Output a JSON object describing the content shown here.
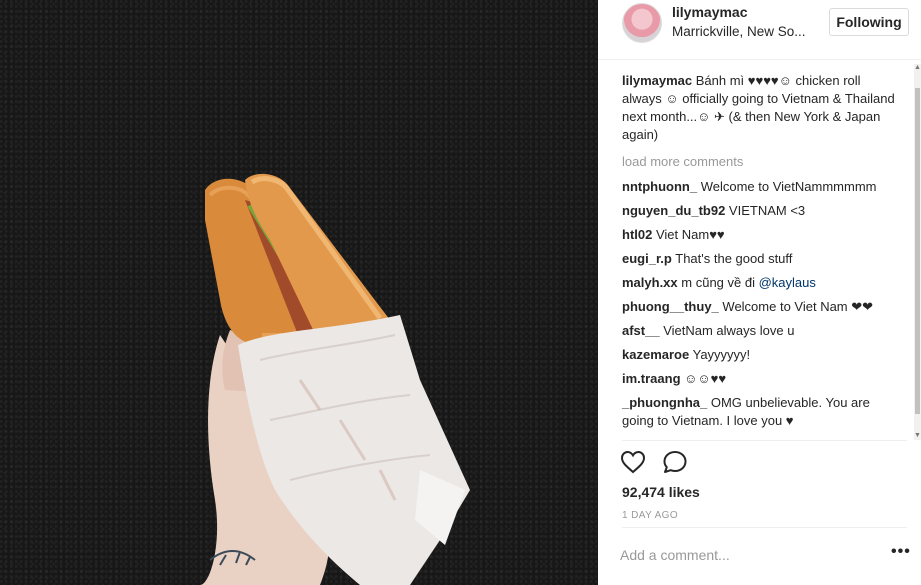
{
  "post": {
    "user": {
      "username": "lilymaymac",
      "location": "Marrickville, New So...",
      "follow_label": "Following"
    },
    "caption": {
      "username": "lilymaymac",
      "text": "Bánh mì ♥♥♥♥☺ chicken roll always ☺ officially going to Vietnam & Thailand next month...☺ ✈ (& then New York & Japan again)"
    },
    "load_more_label": "load more comments",
    "comments": [
      {
        "username": "nntphuonn_",
        "text": "Welcome to VietNammmmmm"
      },
      {
        "username": "nguyen_du_tb92",
        "text": "VIETNAM <3"
      },
      {
        "username": "htl02",
        "text": "Viet Nam♥♥"
      },
      {
        "username": "eugi_r.p",
        "text": "That's the good stuff"
      },
      {
        "username": "malyh.xx",
        "text": "m cũng về đi ",
        "mention": "@kaylaus"
      },
      {
        "username": "phuong__thuy_",
        "text": "Welcome to Viet Nam ❤❤"
      },
      {
        "username": "afst__",
        "text": "VietNam always love u"
      },
      {
        "username": "kazemaroe",
        "text": "Yayyyyyy!"
      },
      {
        "username": "im.traang",
        "text": "☺☺♥♥"
      },
      {
        "username": "_phuongnha_",
        "text": "OMG unbelievable. You are going to Vietnam. I love you ♥"
      }
    ],
    "likes": "92,474 likes",
    "timestamp": "1 DAY AGO",
    "add_comment_placeholder": "Add a comment...",
    "more_label": "•••",
    "icons": {
      "like": "heart-icon",
      "comment": "speech-bubble-icon",
      "options": "ellipsis-icon"
    }
  }
}
